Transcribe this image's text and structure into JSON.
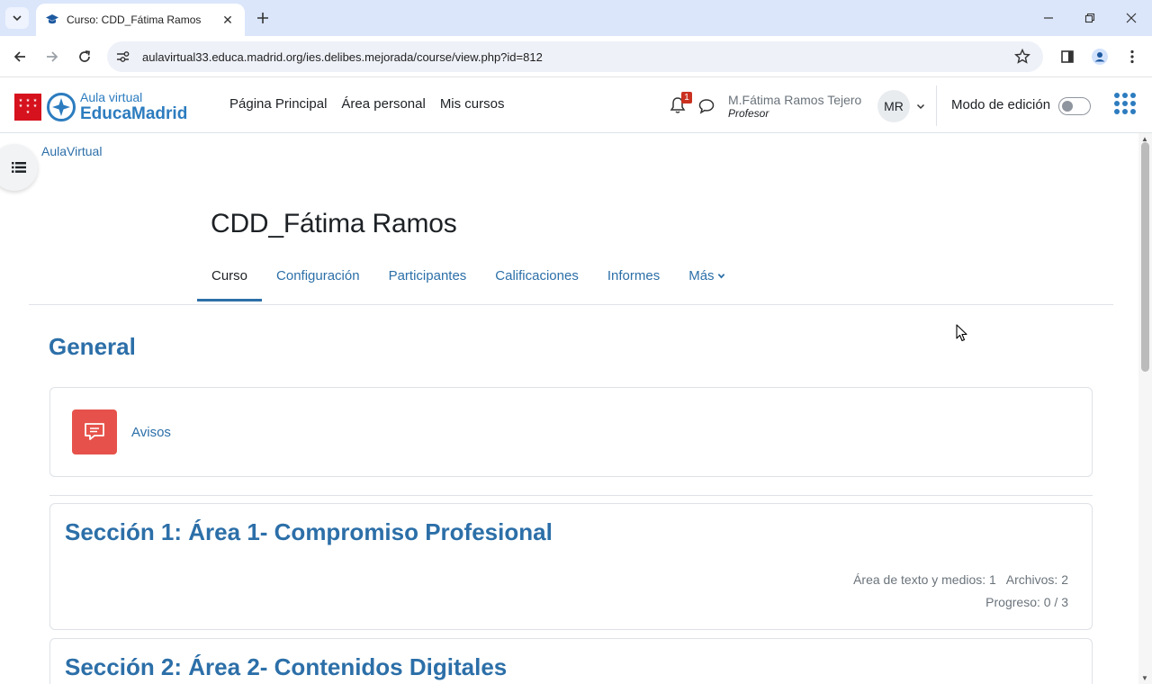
{
  "browser": {
    "tab_title": "Curso: CDD_Fátima Ramos",
    "url": "aulavirtual33.educa.madrid.org/ies.delibes.mejorada/course/view.php?id=812"
  },
  "navbar": {
    "logo_line1": "Aula virtual",
    "logo_line2": "EducaMadrid",
    "links": [
      "Página Principal",
      "Área personal",
      "Mis cursos"
    ],
    "notification_count": "1",
    "user_name": "M.Fátima Ramos Tejero",
    "user_role": "Profesor",
    "avatar_initials": "MR",
    "edit_mode_label": "Modo de edición",
    "edit_mode_on": false
  },
  "breadcrumb": "AulaVirtual",
  "course": {
    "title": "CDD_Fátima Ramos",
    "tabs": [
      "Curso",
      "Configuración",
      "Participantes",
      "Calificaciones",
      "Informes",
      "Más"
    ],
    "active_tab": "Curso"
  },
  "general": {
    "heading": "General",
    "activity": "Avisos"
  },
  "sections": [
    {
      "title": "Sección 1: Área 1- Compromiso Profesional",
      "meta": "Área de texto y medios: 1   Archivos: 2",
      "progress": "Progreso: 0 / 3"
    },
    {
      "title": "Sección 2: Área 2- Contenidos Digitales"
    }
  ],
  "colors": {
    "link": "#2c6fa8",
    "brand_blue": "#2c7cbf",
    "avisos": "#e6524b",
    "madrid_red": "#d5121d"
  }
}
